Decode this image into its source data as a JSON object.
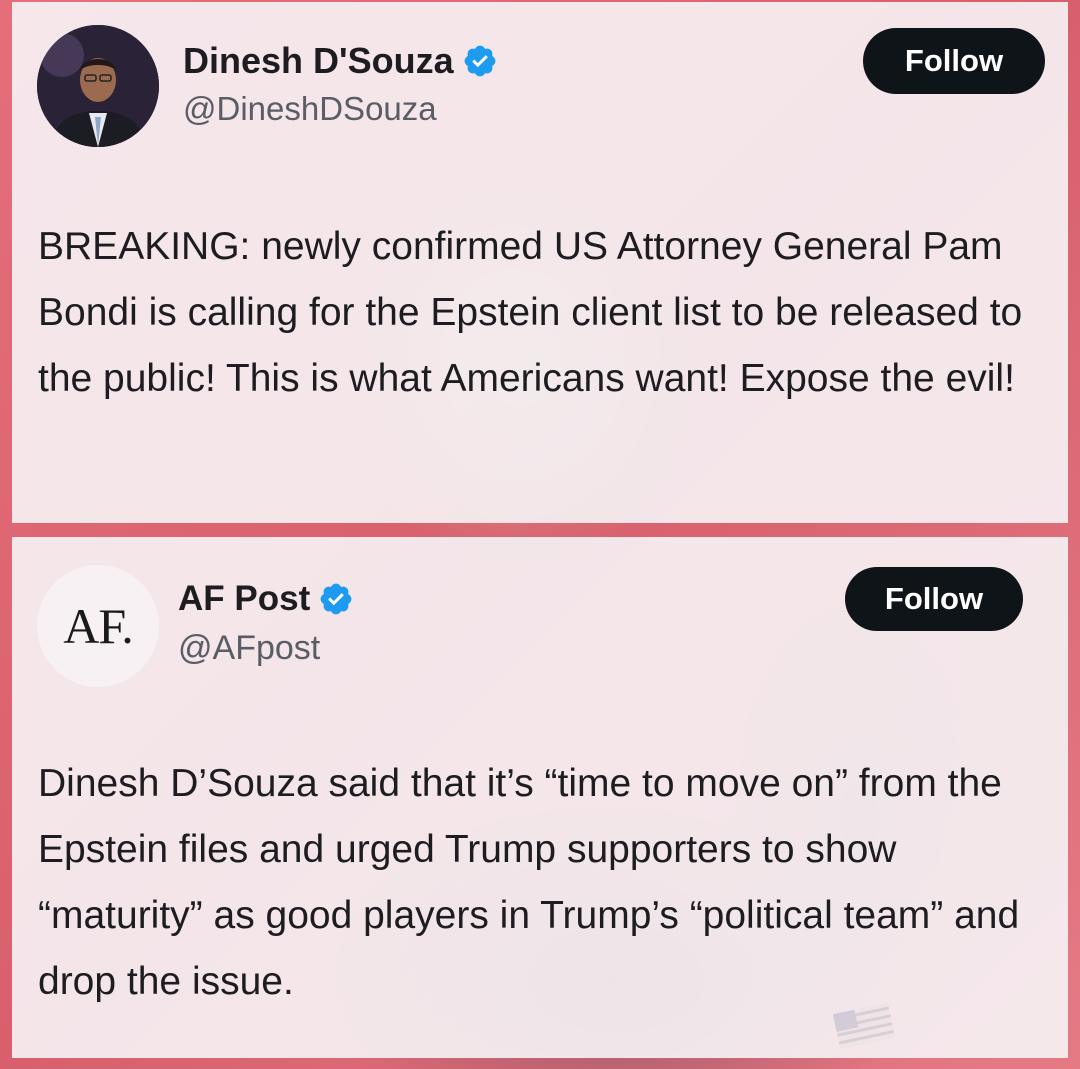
{
  "tweets": [
    {
      "display_name": "Dinesh D'Souza",
      "handle": "@DineshDSouza",
      "follow_label": "Follow",
      "verified": true,
      "avatar_icon": "person-photo-avatar",
      "text": "BREAKING: newly confirmed US Attorney General Pam Bondi is calling for the Epstein client list to be released to the public! This is what Americans want! Expose the evil!"
    },
    {
      "display_name": "AF Post",
      "handle": "@AFpost",
      "follow_label": "Follow",
      "verified": true,
      "avatar_logo_text": "AF.",
      "text": "Dinesh D’Souza said that it’s “time to move on” from the Epstein files and urged Trump supporters to show “maturity” as good players in Trump’s “political team” and drop the issue."
    }
  ],
  "colors": {
    "verified_blue": "#1d9bf0",
    "follow_bg": "#0f1419",
    "follow_text": "#ffffff",
    "background_red": "#e0707a"
  }
}
